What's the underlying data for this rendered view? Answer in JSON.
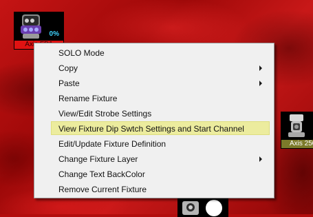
{
  "fixtures": [
    {
      "name": "Axis FD1",
      "percent": "0%",
      "label_bg": "#e01212",
      "icon": "moving-head-fixture-icon"
    },
    {
      "name": "Axis 250",
      "percent": "",
      "label_bg": "#7c7a2a",
      "icon": "moving-head-fixture-icon"
    },
    {
      "name": "",
      "percent": "",
      "icon": "moving-head-fixture-icon"
    }
  ],
  "context_menu": {
    "items": [
      {
        "label": "SOLO Mode",
        "has_submenu": false,
        "highlighted": false
      },
      {
        "label": "Copy",
        "has_submenu": true,
        "highlighted": false
      },
      {
        "label": "Paste",
        "has_submenu": true,
        "highlighted": false
      },
      {
        "label": "Rename Fixture",
        "has_submenu": false,
        "highlighted": false
      },
      {
        "label": "View/Edit Strobe Settings",
        "has_submenu": false,
        "highlighted": false
      },
      {
        "label": "View Fixture Dip Swtch Settings and Start Channel",
        "has_submenu": false,
        "highlighted": true
      },
      {
        "label": "Edit/Update Fixture Definition",
        "has_submenu": false,
        "highlighted": false
      },
      {
        "label": "Change Fixture Layer",
        "has_submenu": true,
        "highlighted": false
      },
      {
        "label": "Change Text BackColor",
        "has_submenu": false,
        "highlighted": false
      },
      {
        "label": "Remove Current Fixture",
        "has_submenu": false,
        "highlighted": false
      }
    ]
  },
  "colors": {
    "canvas_background": "#b30d0d",
    "menu_background": "#f0f0f0",
    "highlight": "#ecec9e",
    "percent_text": "#3fd4ff"
  }
}
